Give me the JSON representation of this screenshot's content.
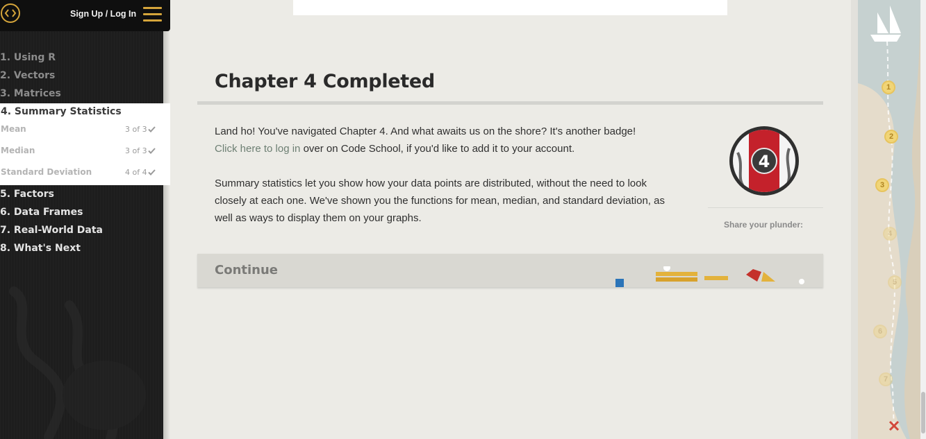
{
  "header": {
    "signup_label": "Sign Up / Log In"
  },
  "sidebar": {
    "chapters_before": [
      {
        "label": "1. Using R"
      },
      {
        "label": "2. Vectors"
      },
      {
        "label": "3. Matrices"
      }
    ],
    "active_chapter": {
      "label": "4. Summary Statistics",
      "lessons": [
        {
          "label": "Mean",
          "progress": "3 of 3"
        },
        {
          "label": "Median",
          "progress": "3 of 3"
        },
        {
          "label": "Standard Deviation",
          "progress": "4 of 4"
        }
      ]
    },
    "chapters_after": [
      {
        "label": "5. Factors"
      },
      {
        "label": "6. Data Frames"
      },
      {
        "label": "7. Real-World Data"
      },
      {
        "label": "8. What's Next"
      }
    ]
  },
  "main": {
    "title": "Chapter 4 Completed",
    "para1_text": "Land ho! You've navigated Chapter 4. And what awaits us on the shore? It's another badge!",
    "login_link": "Click here to log in",
    "para1_rest": " over on Code School, if you'd like to add it to your account.",
    "para2": "Summary statistics let you show how your data points are distributed, without the need to look closely at each one. We've shown you the functions for mean, median, and standard deviation, as well as ways to display them on your graphs.",
    "badge_number": "4",
    "share_label": "Share your plunder:",
    "continue_label": "Continue"
  },
  "map": {
    "waypoints": [
      {
        "label": "1",
        "completed": true
      },
      {
        "label": "2",
        "completed": true
      },
      {
        "label": "3",
        "completed": true
      },
      {
        "label": "4",
        "completed": false
      },
      {
        "label": "5",
        "completed": false
      },
      {
        "label": "6",
        "completed": false
      },
      {
        "label": "7",
        "completed": false
      }
    ]
  },
  "colors": {
    "accent_gold": "#d5a53b",
    "link_green": "#6d7f73",
    "badge_red": "#c4212b"
  }
}
